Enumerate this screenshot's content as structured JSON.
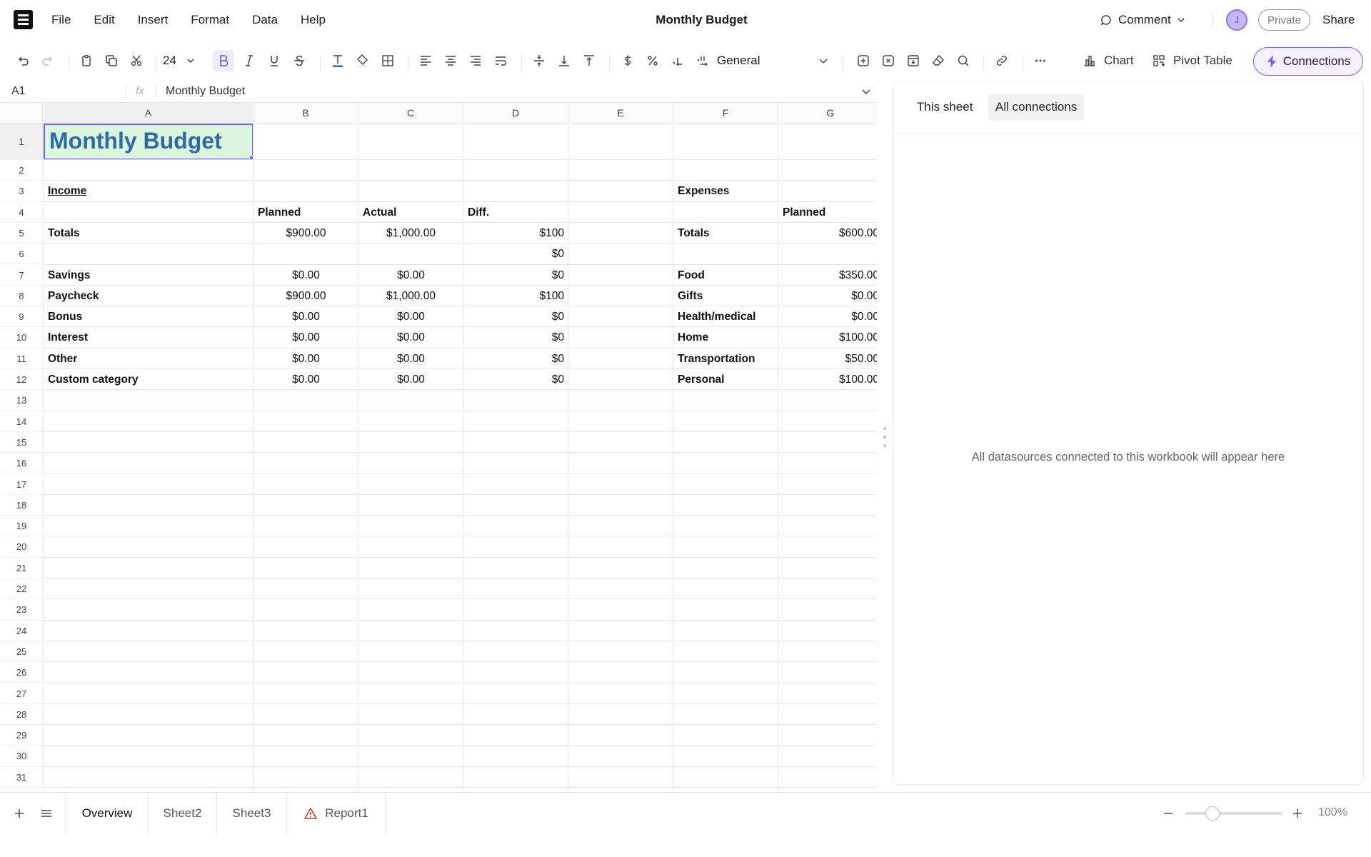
{
  "app": {
    "title": "Monthly Budget",
    "menus": [
      "File",
      "Edit",
      "Insert",
      "Format",
      "Data",
      "Help"
    ],
    "comment_label": "Comment",
    "avatar_initial": "J",
    "privacy_label": "Private",
    "share_label": "Share"
  },
  "toolbar": {
    "font_size": "24",
    "number_format": "General",
    "chart_label": "Chart",
    "pivot_label": "Pivot Table",
    "connections_label": "Connections",
    "accent_color": "#7b5cf0"
  },
  "formula_bar": {
    "cell_ref": "A1",
    "fx": "fx",
    "value": "Monthly Budget"
  },
  "grid": {
    "columns": [
      "A",
      "B",
      "C",
      "D",
      "E",
      "F",
      "G"
    ],
    "selected_column": "A",
    "row_count": 31,
    "selected_row": 1,
    "title_cell": "Monthly Budget",
    "title_fill": "#d9f5dc",
    "title_color": "#2f6aa8",
    "income": {
      "heading": "Income",
      "headers": [
        "Planned",
        "Actual",
        "Diff."
      ],
      "rows": [
        {
          "label": "Totals",
          "planned": "$900.00",
          "actual": "$1,000.00",
          "diff": "$100"
        },
        {
          "label": "",
          "planned": "",
          "actual": "",
          "diff": "$0"
        },
        {
          "label": "Savings",
          "planned": "$0.00",
          "actual": "$0.00",
          "diff": "$0"
        },
        {
          "label": "Paycheck",
          "planned": "$900.00",
          "actual": "$1,000.00",
          "diff": "$100"
        },
        {
          "label": "Bonus",
          "planned": "$0.00",
          "actual": "$0.00",
          "diff": "$0"
        },
        {
          "label": "Interest",
          "planned": "$0.00",
          "actual": "$0.00",
          "diff": "$0"
        },
        {
          "label": "Other",
          "planned": "$0.00",
          "actual": "$0.00",
          "diff": "$0"
        },
        {
          "label": "Custom category",
          "planned": "$0.00",
          "actual": "$0.00",
          "diff": "$0"
        }
      ]
    },
    "expenses": {
      "heading": "Expenses",
      "headers": [
        "Planned"
      ],
      "rows": [
        {
          "label": "Totals",
          "planned": "$600.00"
        },
        {
          "label": "",
          "planned": ""
        },
        {
          "label": "Food",
          "planned": "$350.00"
        },
        {
          "label": "Gifts",
          "planned": "$0.00"
        },
        {
          "label": "Health/medical",
          "planned": "$0.00"
        },
        {
          "label": "Home",
          "planned": "$100.00"
        },
        {
          "label": "Transportation",
          "planned": "$50.00"
        },
        {
          "label": "Personal",
          "planned": "$100.00"
        }
      ]
    }
  },
  "side_panel": {
    "tabs": [
      "This sheet",
      "All connections"
    ],
    "active_tab": "All connections",
    "empty_message": "All datasources connected to this workbook will appear here"
  },
  "sheets": {
    "tabs": [
      "Overview",
      "Sheet2",
      "Sheet3",
      "Report1"
    ],
    "active": "Overview",
    "warning_tab": "Report1",
    "zoom": "100%",
    "zoom_fraction": 0.28
  }
}
